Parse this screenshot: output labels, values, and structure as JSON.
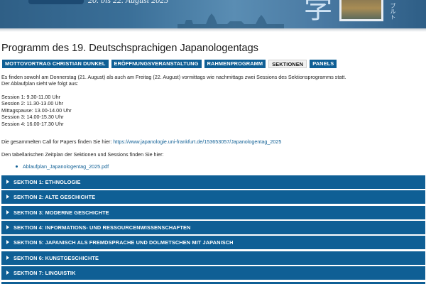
{
  "banner": {
    "date_text": "20. bis 22. August 2025",
    "kanji": "学",
    "katakana": "ブルト"
  },
  "page": {
    "title": "Programm des 19. Deutschsprachigen Japanologentags"
  },
  "tabs": [
    {
      "label": "MOTTOVORTRAG CHRISTIAN DUNKEL",
      "active": false
    },
    {
      "label": "ERÖFFNUNGSVERANSTALTUNG",
      "active": false
    },
    {
      "label": "RAHMENPROGRAMM",
      "active": false
    },
    {
      "label": "SEKTIONEN",
      "active": true
    },
    {
      "label": "PANELS",
      "active": false
    }
  ],
  "content": {
    "intro_line1": "Es finden sowohl am Donnerstag (21. August) als auch am Freitag (22. August) vormittags wie nachmittags zwei Sessions des Sektionsprogramms statt.",
    "intro_line2": "Der Ablaufplan sieht wie folgt aus:",
    "schedule": [
      "Session 1: 9.30-11.00 Uhr",
      "Session 2: 11.30-13.00 Uhr",
      "Mittagspause: 13.00-14.00 Uhr",
      "Session 3: 14.00-15.30 Uhr",
      "Session 4: 16.00-17.30 Uhr"
    ],
    "cfp_prefix": "Die gesammelten Call for Papers finden Sie hier: ",
    "cfp_link": "https://www.japanologie.uni-frankfurt.de/153653057/Japanologentag_2025",
    "table_intro": "Den tabellarischen Zeitplan der Sektionen und Sessions finden Sie hier:",
    "pdf_link": "Ablaufplan_Japanologentag_2025.pdf"
  },
  "sections": [
    "SEKTION 1: ETHNOLOGIE",
    "SEKTION 2: ALTE GESCHICHTE",
    "SEKTION 3: MODERNE GESCHICHTE",
    "SEKTION 4: INFORMATIONS- UND RESSOURCENWISSENSCHAFTEN",
    "SEKTION 5: JAPANISCH ALS FREMDSPRACHE UND DOLMETSCHEN MIT JAPANISCH",
    "SEKTION 6: KUNSTGESCHICHTE",
    "SEKTION 7: LINGUISTIK"
  ],
  "colors": {
    "accent": "#0f5f95",
    "link": "#0f5f95"
  }
}
